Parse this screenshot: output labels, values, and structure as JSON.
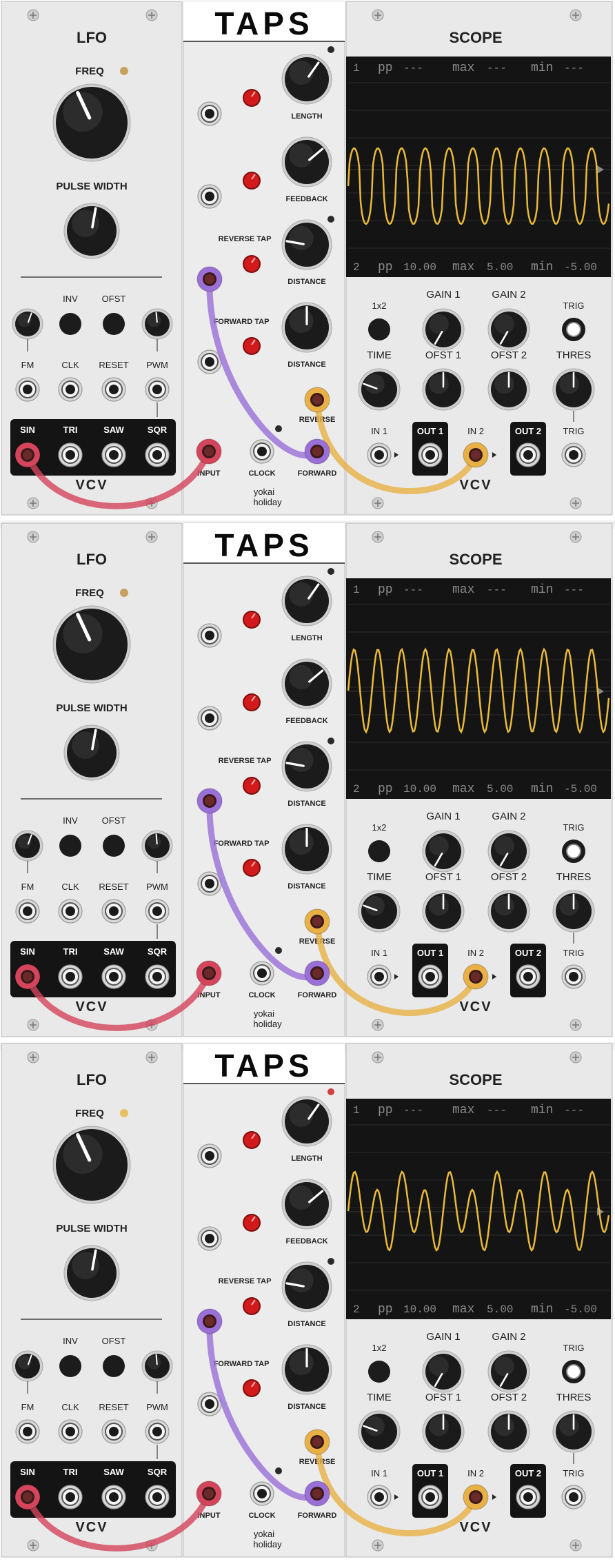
{
  "lfo": {
    "title": "LFO",
    "freq_label": "FREQ",
    "pulse_width_label": "PULSE WIDTH",
    "inv_label": "INV",
    "ofst_label": "OFST",
    "fm_label": "FM",
    "clk_label": "CLK",
    "reset_label": "RESET",
    "pwm_label": "PWM",
    "outputs": [
      "SIN",
      "TRI",
      "SAW",
      "SQR"
    ],
    "logo": "VCV"
  },
  "taps": {
    "title": "TAPS",
    "length_label": "LENGTH",
    "feedback_label": "FEEDBACK",
    "reverse_tap_label": "REVERSE TAP",
    "distance_label": "DISTANCE",
    "forward_tap_label": "FORWARD TAP",
    "reverse_label": "REVERSE",
    "input_label": "INPUT",
    "clock_label": "CLOCK",
    "forward_label": "FORWARD",
    "brand_line1": "yokai",
    "brand_line2": "holiday"
  },
  "scope": {
    "title": "SCOPE",
    "ch1": {
      "num": "1",
      "pp": "pp",
      "pp_val": "---",
      "max": "max",
      "max_val": "---",
      "min": "min",
      "min_val": "---"
    },
    "ch2": {
      "num": "2",
      "pp": "pp",
      "pp_val": "10.00",
      "max": "max",
      "max_val": "5.00",
      "min": "min",
      "min_val": "-5.00"
    },
    "x1x2_label": "1x2",
    "gain1_label": "GAIN 1",
    "gain2_label": "GAIN 2",
    "trig_label": "TRIG",
    "time_label": "TIME",
    "ofst1_label": "OFST 1",
    "ofst2_label": "OFST 2",
    "thres_label": "THRES",
    "in1_label": "IN 1",
    "out1_label": "OUT 1",
    "in2_label": "IN 2",
    "out2_label": "OUT 2",
    "trig_in_label": "TRIG",
    "logo": "VCV"
  },
  "rack_instances": [
    {
      "wave_style": "pulse",
      "taps_light_color": "#2a2a2a",
      "lfo_light_color": "#c8a060"
    },
    {
      "wave_style": "sine",
      "taps_light_color": "#2a2a2a",
      "lfo_light_color": "#c8a060"
    },
    {
      "wave_style": "mixed",
      "taps_light_color": "#d04040",
      "lfo_light_color": "#e8c060"
    }
  ],
  "colors": {
    "panel": "#e9e9e9",
    "screen": "#141414",
    "trace": "#e8b93a",
    "cable_red": "#d4455b",
    "cable_purple": "#9a6fd8",
    "cable_yellow": "#e8b045",
    "tap_knob": "#d21a1a"
  },
  "icons": {
    "screw": "screw-icon",
    "jack": "jack-icon",
    "knob": "knob-icon"
  }
}
